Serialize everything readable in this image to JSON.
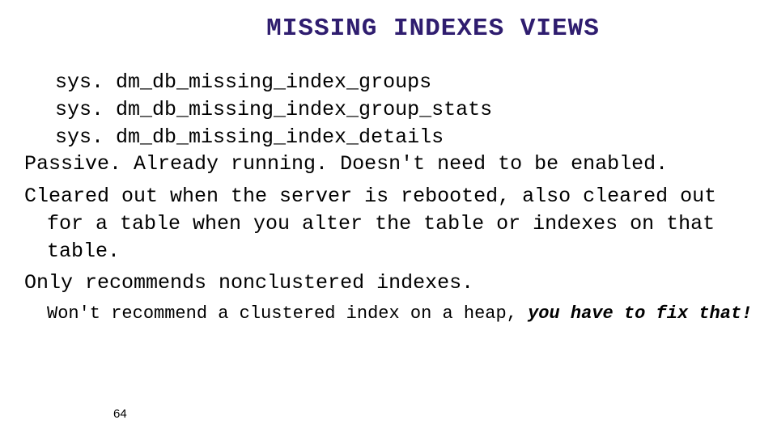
{
  "title": "MISSING INDEXES VIEWS",
  "views": {
    "line1": "sys. dm_db_missing_index_groups",
    "line2": "sys. dm_db_missing_index_group_stats",
    "line3": "sys. dm_db_missing_index_details"
  },
  "bullets": {
    "passive": "Passive.  Already running. Doesn't need to be enabled.",
    "cleared": "Cleared out when the server is rebooted, also cleared out for a table when you alter the table or indexes on that table.",
    "recommends": "Only recommends nonclustered indexes.",
    "sub_prefix": "Won't recommend a clustered index on a heap, ",
    "sub_emph": "you have to fix that!"
  },
  "page_number": "64"
}
